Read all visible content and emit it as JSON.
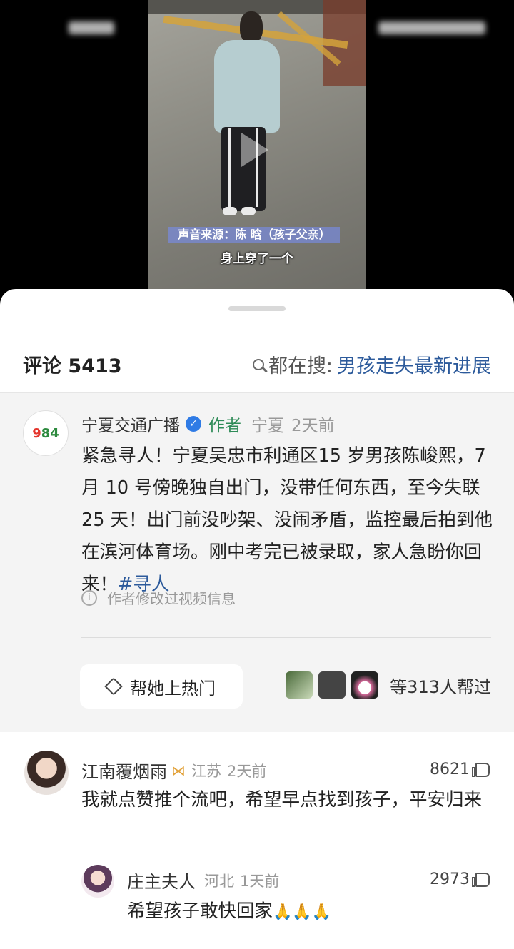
{
  "video": {
    "caption_source": "声音来源：陈 晗（孩子父亲）",
    "caption_speech": "身上穿了一个"
  },
  "header": {
    "comments_label": "评论",
    "comments_count": "5413",
    "search_prefix": "都在搜:",
    "search_term": "男孩走失最新进展"
  },
  "author_post": {
    "avatar_text_a": "9",
    "avatar_text_b": "84",
    "name": "宁夏交通广播",
    "verified_icon": "verified-check-icon",
    "tag": "作者",
    "location": "宁夏",
    "time": "2天前",
    "text": "紧急寻人！宁夏吴忠市利通区15 岁男孩陈峻熙，7 月 10 号傍晚独自出门，没带任何东西，至今失联 25 天！出门前没吵架、没闹矛盾，监控最后拍到他在滨河体育场。刚中考完已被录取，家人急盼你回来！",
    "hashtag": "#寻人",
    "edited_note": "作者修改过视频信息",
    "boost_label": "帮她上热门",
    "helpers_label": "等313人帮过"
  },
  "comments": [
    {
      "name": "江南覆烟雨",
      "badge": "⋈",
      "location": "江苏",
      "time": "2天前",
      "likes": "8621",
      "text": "我就点赞推个流吧，希望早点找到孩子，平安归来"
    },
    {
      "name": "庄主夫人",
      "location": "河北",
      "time": "1天前",
      "likes": "2973",
      "text": "希望孩子敢快回家",
      "emoji": "🙏🙏🙏"
    }
  ],
  "colors": {
    "link_blue": "#2c5a9b",
    "author_green": "#2e8b57",
    "verified_blue": "#2f7be5"
  }
}
